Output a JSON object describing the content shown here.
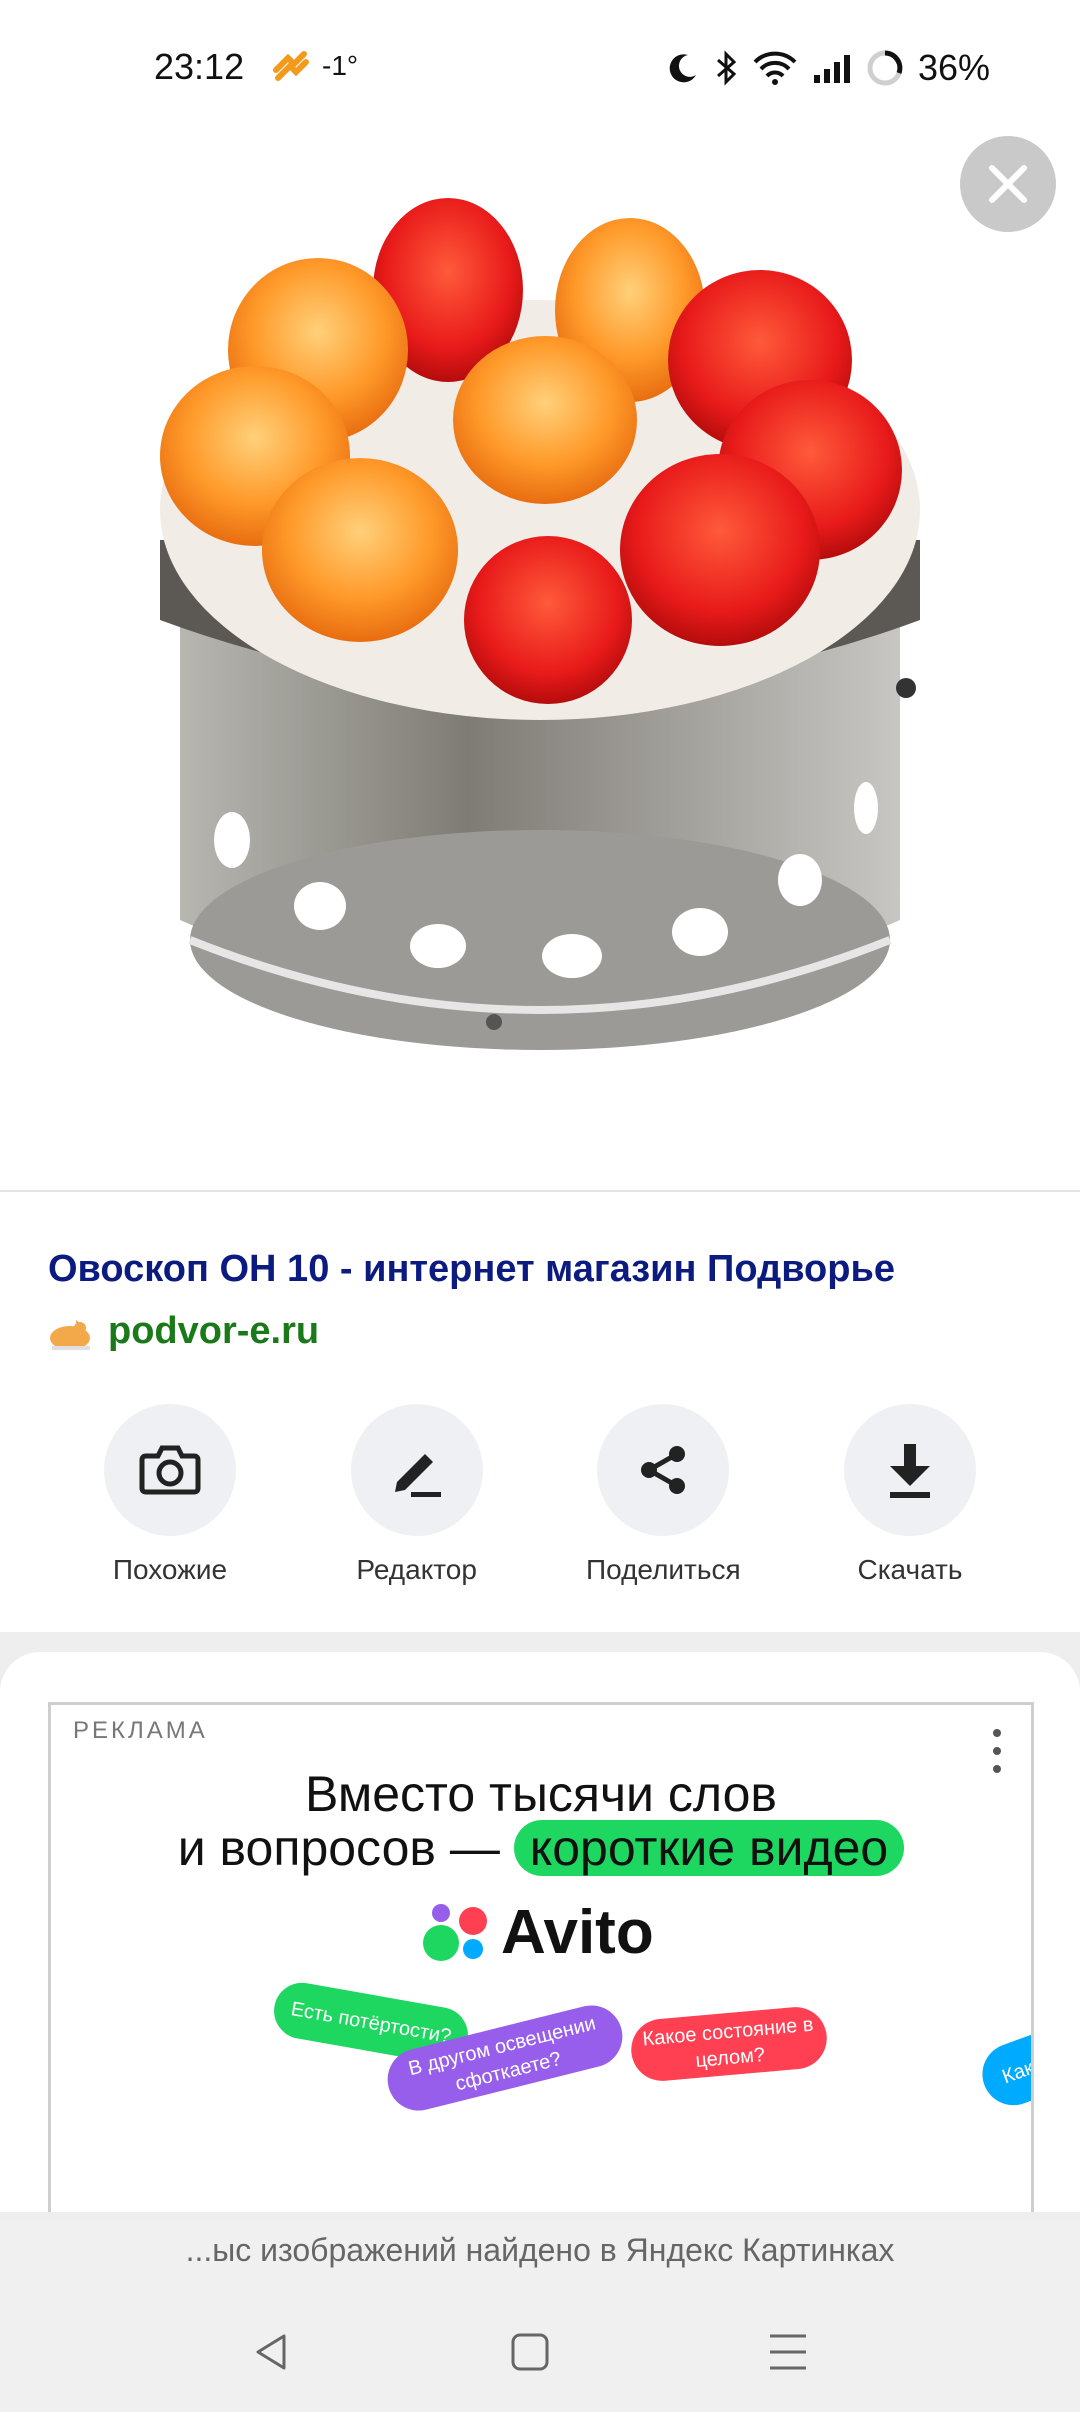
{
  "status_bar": {
    "time": "23:12",
    "temperature": "-1°",
    "battery": "36%",
    "icons": [
      "weather-icon",
      "moon-icon",
      "bluetooth-icon",
      "wifi-icon",
      "signal-icon",
      "battery-ring-icon"
    ]
  },
  "viewer": {
    "close_icon": "close-icon",
    "image_description_icon": "product-photo"
  },
  "result": {
    "title": "Овоскоп ОН 10 - интернет магазин Подворье",
    "site": "podvor-e.ru",
    "actions": [
      {
        "label": "Похожие",
        "icon": "camera-search-icon"
      },
      {
        "label": "Редактор",
        "icon": "pencil-icon"
      },
      {
        "label": "Поделиться",
        "icon": "share-icon"
      },
      {
        "label": "Скачать",
        "icon": "download-icon"
      }
    ]
  },
  "ad": {
    "label": "РЕКЛАМА",
    "headline_line1": "Вместо тысячи слов",
    "headline_line2_prefix": "и вопросов —",
    "headline_highlight": "короткие видео",
    "brand": "Avito",
    "bubbles": [
      {
        "text": "Есть потёртости?",
        "color": "#1ed760"
      },
      {
        "text": "В другом освещении сфоткаете?",
        "color": "#965eeb"
      },
      {
        "text": "Какое состояние в целом?",
        "color": "#ff4053"
      },
      {
        "text": "Како",
        "color": "#00aaff"
      }
    ]
  },
  "footer": {
    "text": "...ыс изображений найдено в Яндекс Картинках"
  },
  "nav": {
    "back": "back-icon",
    "home": "home-icon",
    "recents": "menu-icon"
  }
}
